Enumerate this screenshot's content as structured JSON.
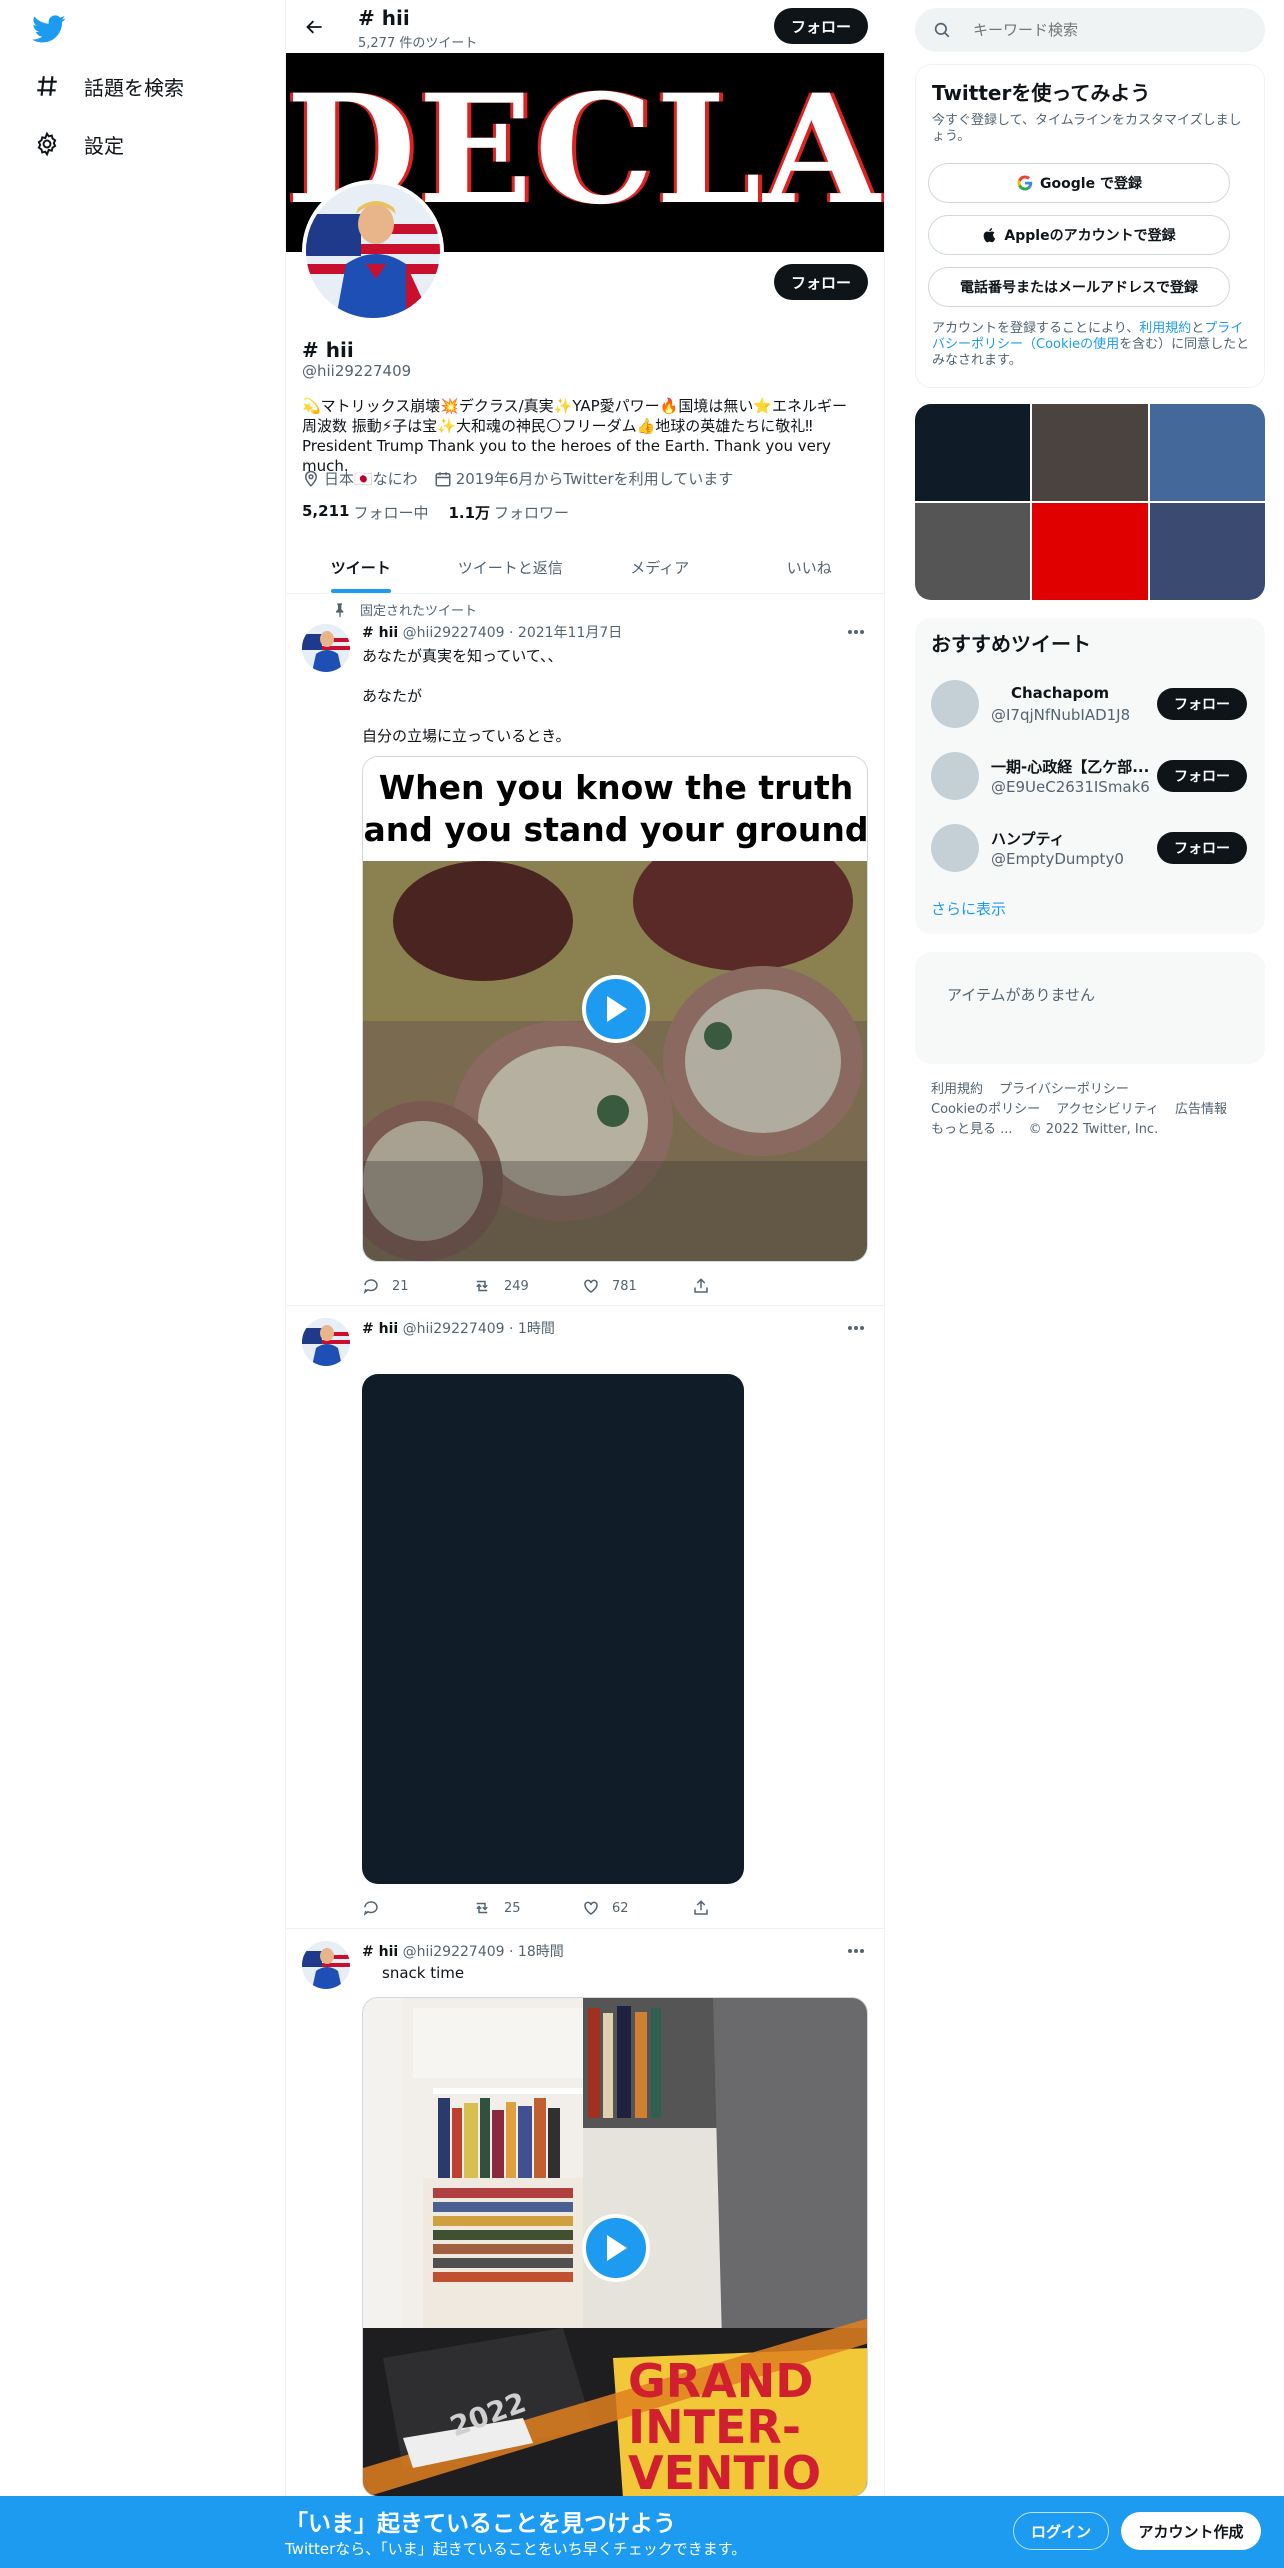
{
  "nav": {
    "items": [
      {
        "label": "話題を検索",
        "icon": "hashtag-icon"
      },
      {
        "label": "設定",
        "icon": "gear-icon"
      }
    ]
  },
  "header": {
    "title": "# hii",
    "tweet_count": "5,277 件のツイート",
    "follow_label": "フォロー"
  },
  "banner": {
    "text": "DECLAS"
  },
  "profile": {
    "name": "# hii",
    "handle": "@hii29227409",
    "follow_label": "フォロー",
    "bio_line1": "💫マトリックス崩壊💥デクラス/真実✨YAP愛パワー🔥国境は無い⭐エネルギー",
    "bio_line2": "周波数 振動⚡子は宝✨大和魂の神民🌕フリーダム👍地球の英雄たちに敬礼‼",
    "bio_line3": "President Trump Thank you to the heroes of the Earth. Thank you very much.",
    "location": "日本🇯🇵なにわ",
    "joined": "2019年6月からTwitterを利用しています",
    "following_count": "5,211",
    "following_label": "フォロー中",
    "followers_count": "1.1万",
    "followers_label": "フォロワー"
  },
  "tabs": [
    {
      "label": "ツイート",
      "active": true
    },
    {
      "label": "ツイートと返信",
      "active": false
    },
    {
      "label": "メディア",
      "active": false
    },
    {
      "label": "いいね",
      "active": false
    }
  ],
  "tweets": [
    {
      "pinned_label": "固定されたツイート",
      "name": "# hii",
      "handle": "@hii29227409",
      "date": "2021年11月7日",
      "text_lines": [
        "あなたが真実を知っていて、、",
        "あなたが",
        "自分の立場に立っているとき。"
      ],
      "media_caption_line1": "When you know the truth",
      "media_caption_line2": "and you stand your ground",
      "replies": "21",
      "retweets": "249",
      "likes": "781"
    },
    {
      "name": "# hii",
      "handle": "@hii29227409",
      "date": "1時間",
      "replies": "",
      "retweets": "25",
      "likes": "62"
    },
    {
      "name": "# hii",
      "handle": "@hii29227409",
      "date": "18時間",
      "text": "snack time",
      "book_text_line1": "GRAND",
      "book_text_line2": "INTER-",
      "book_text_line3": "VENTIO",
      "notebook_year": "2022"
    }
  ],
  "sidebar": {
    "search_placeholder": "キーワード検索",
    "signup": {
      "title": "Twitterを使ってみよう",
      "subtitle": "今すぐ登録して、タイムラインをカスタマイズしましょう。",
      "google_label": "Google で登録",
      "apple_label": "Appleのアカウントで登録",
      "phone_label": "電話番号またはメールアドレスで登録",
      "terms_prefix": "アカウントを登録することにより、",
      "terms_link": "利用規約",
      "terms_and": "と",
      "privacy_link": "プライバシーポリシー",
      "cookie_link": "（Cookieの使用",
      "terms_suffix": "を含む）に同意したとみなされます。"
    },
    "recommend": {
      "title": "おすすめツイート",
      "users": [
        {
          "name": "Chachapom",
          "handle": "@I7qjNfNubIAD1J8"
        },
        {
          "name": "一期-心政経【乙ケ部...",
          "handle": "@E9UeC2631ISmak6"
        },
        {
          "name": "ハンプティ",
          "handle": "@EmptyDumpty0"
        }
      ],
      "follow_label": "フォロー",
      "more_label": "さらに表示"
    },
    "empty_label": "アイテムがありません",
    "footer": {
      "links": [
        "利用規約",
        "プライバシーポリシー",
        "Cookieのポリシー",
        "アクセシビリティ",
        "広告情報",
        "もっと見る ..."
      ],
      "copyright": "© 2022 Twitter, Inc."
    }
  },
  "bottombar": {
    "title": "「いま」起きていることを見つけよう",
    "subtitle": "Twitterなら、「いま」起きていることをいち早くチェックできます。",
    "login_label": "ログイン",
    "signup_label": "アカウント作成"
  },
  "colors": {
    "accent": "#1d9bf0",
    "text": "#0f1419",
    "muted": "#536471",
    "grid": [
      "#0f1c28",
      "#4a4340",
      "#44689a",
      "#555555",
      "#e00000",
      "#3b4a70"
    ]
  }
}
